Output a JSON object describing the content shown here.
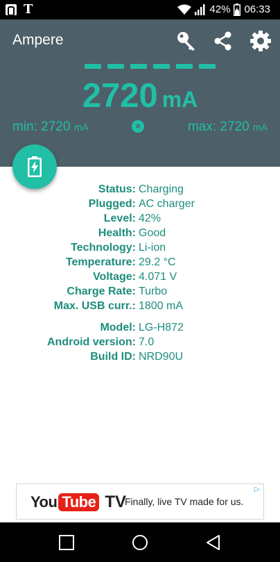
{
  "status_bar": {
    "battery_percent": "42%",
    "time": "06:33",
    "icons": [
      "outlook-icon",
      "t-mobile-icon",
      "wifi-icon",
      "signal-icon",
      "battery-charging-icon"
    ]
  },
  "header": {
    "app_title": "Ampere",
    "current_value": "2720",
    "current_unit": "mA",
    "min_label": "min: 2720",
    "min_unit": "mA",
    "max_label": "max: 2720",
    "max_unit": "mA",
    "reset_glyph": "×",
    "actions": [
      "key-icon",
      "share-icon",
      "settings-icon"
    ]
  },
  "info": {
    "rows": [
      {
        "label": "Status:",
        "value": "Charging"
      },
      {
        "label": "Plugged:",
        "value": "AC charger"
      },
      {
        "label": "Level:",
        "value": "42%"
      },
      {
        "label": "Health:",
        "value": "Good"
      },
      {
        "label": "Technology:",
        "value": "Li-ion"
      },
      {
        "label": "Temperature:",
        "value": "29.2 °C"
      },
      {
        "label": "Voltage:",
        "value": "4.071 V"
      },
      {
        "label": "Charge Rate:",
        "value": "Turbo"
      },
      {
        "label": "Max. USB curr.:",
        "value": "1800 mA"
      }
    ],
    "device_rows": [
      {
        "label": "Model:",
        "value": "LG-H872"
      },
      {
        "label": "Android version:",
        "value": "7.0"
      },
      {
        "label": "Build ID:",
        "value": "NRD90U"
      }
    ]
  },
  "ad": {
    "brand_you": "You",
    "brand_tube": "Tube",
    "brand_tv": "TV",
    "text": "Finally, live TV made for us.",
    "adchoices_glyph": "▷"
  },
  "colors": {
    "accent": "#21bfa6",
    "header_bg": "#4d5f68",
    "label_text": "#1e8d7d"
  }
}
